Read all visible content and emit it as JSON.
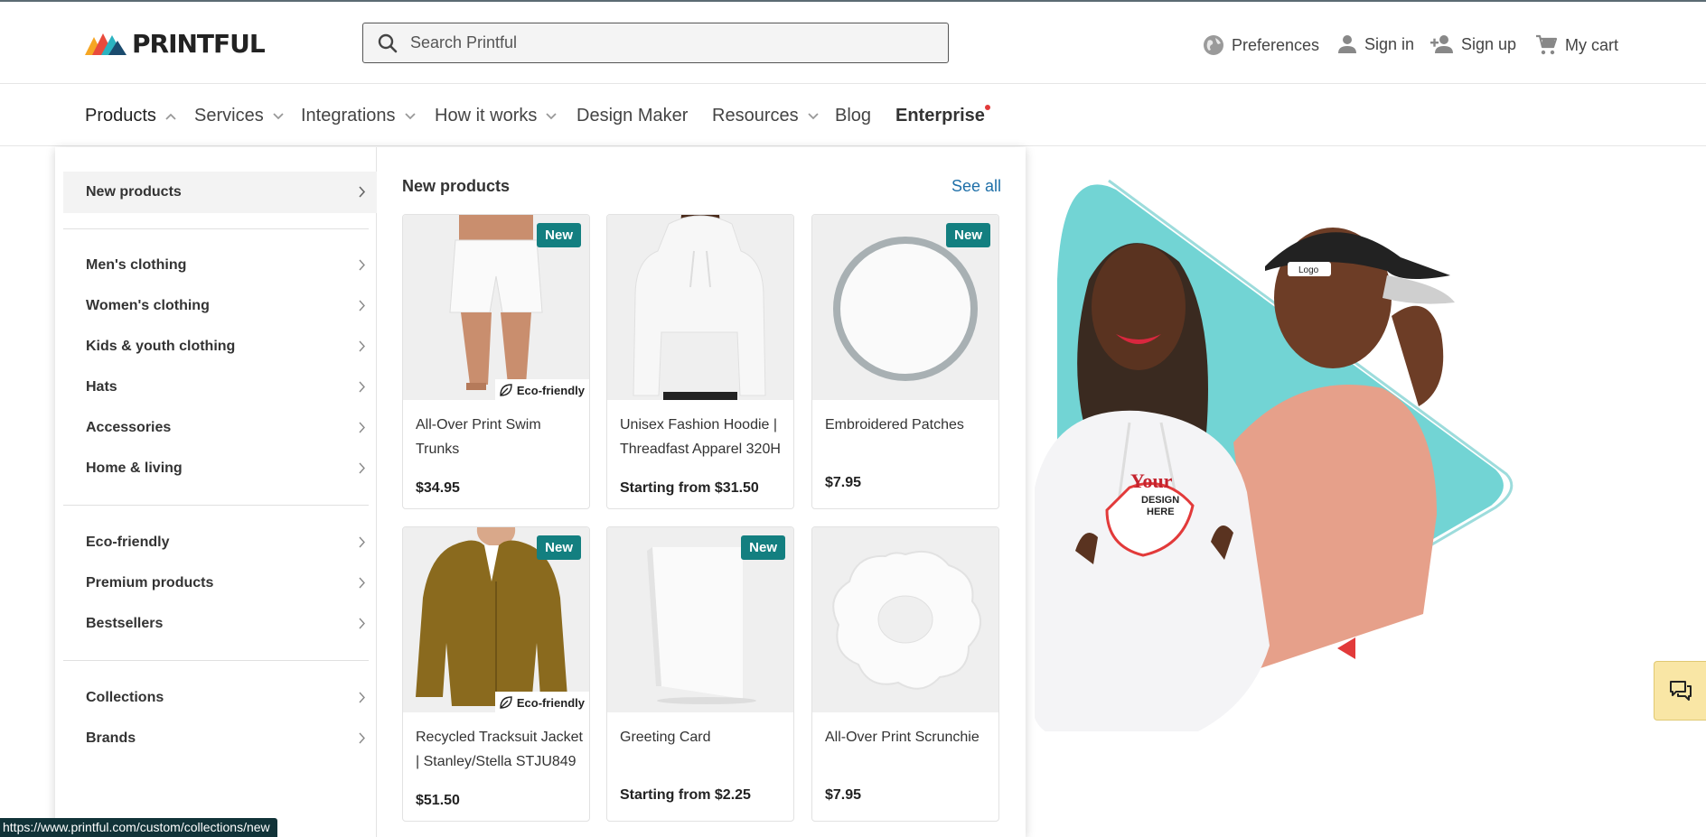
{
  "header": {
    "logo_text": "PRINTFUL",
    "search_placeholder": "Search Printful",
    "preferences": "Preferences",
    "sign_in": "Sign in",
    "sign_up": "Sign up",
    "cart": "My cart"
  },
  "nav": {
    "products": "Products",
    "services": "Services",
    "integrations": "Integrations",
    "how_it_works": "How it works",
    "design_maker": "Design Maker",
    "resources": "Resources",
    "blog": "Blog",
    "enterprise": "Enterprise"
  },
  "sidebar": {
    "items": [
      {
        "label": "New products"
      },
      {
        "label": "Men's clothing"
      },
      {
        "label": "Women's clothing"
      },
      {
        "label": "Kids & youth clothing"
      },
      {
        "label": "Hats"
      },
      {
        "label": "Accessories"
      },
      {
        "label": "Home & living"
      },
      {
        "label": "Eco-friendly"
      },
      {
        "label": "Premium products"
      },
      {
        "label": "Bestsellers"
      },
      {
        "label": "Collections"
      },
      {
        "label": "Brands"
      }
    ]
  },
  "panel": {
    "title": "New products",
    "see_all": "See all",
    "badge_new": "New",
    "badge_eco": "Eco-friendly",
    "products": [
      {
        "name": "All-Over Print Swim Trunks",
        "price": "$34.95"
      },
      {
        "name": "Unisex Fashion Hoodie | Threadfast Apparel 320H",
        "price": "Starting from $31.50"
      },
      {
        "name": "Embroidered Patches",
        "price": "$7.95"
      },
      {
        "name": "Recycled Tracksuit Jacket | Stanley/Stella STJU849",
        "price": "$51.50"
      },
      {
        "name": "Greeting Card",
        "price": "Starting from $2.25"
      },
      {
        "name": "All-Over Print Scrunchie",
        "price": "$7.95"
      }
    ]
  },
  "hero": {
    "print_your": "Your",
    "print_design": "DESIGN",
    "print_here": "HERE",
    "cap_logo": "Logo"
  },
  "status_url": "https://www.printful.com/custom/collections/new",
  "colors": {
    "accent": "#137f80",
    "link": "#1e6fa8",
    "teal": "#72d4d4",
    "red": "#e23a3a"
  }
}
